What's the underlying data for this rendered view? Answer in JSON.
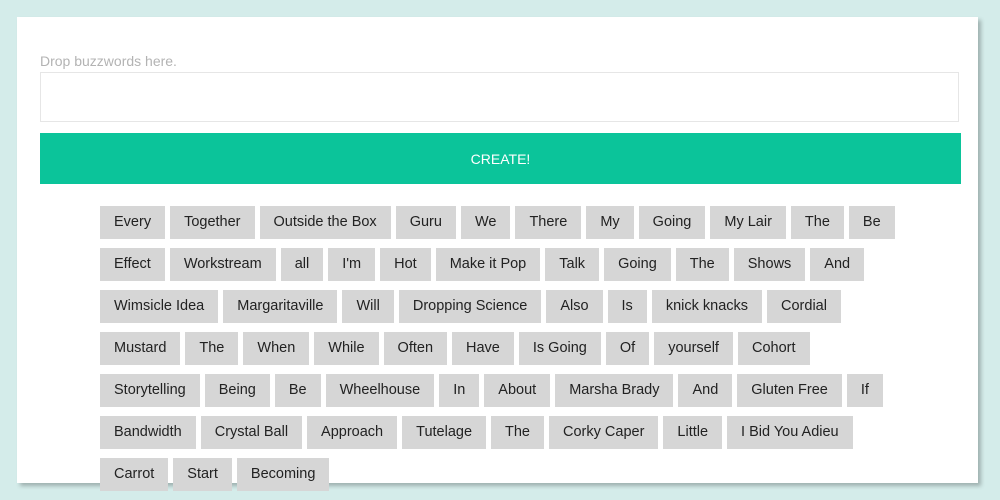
{
  "form": {
    "hint": "Drop buzzwords here.",
    "input_value": "",
    "create_label": "CREATE!"
  },
  "buzzwords": [
    "Every",
    "Together",
    "Outside the Box",
    "Guru",
    "We",
    "There",
    "My",
    "Going",
    "My Lair",
    "The",
    "Be",
    "Effect",
    "Workstream",
    "all",
    "I'm",
    "Hot",
    "Make it Pop",
    "Talk",
    "Going",
    "The",
    "Shows",
    "And",
    "Wimsicle Idea",
    "Margaritaville",
    "Will",
    "Dropping Science",
    "Also",
    "Is",
    "knick knacks",
    "Cordial",
    "Mustard",
    "The",
    "When",
    "While",
    "Often",
    "Have",
    "Is Going",
    "Of",
    "yourself",
    "Cohort",
    "Storytelling",
    "Being",
    "Be",
    "Wheelhouse",
    "In",
    "About",
    "Marsha Brady",
    "And",
    "Gluten Free",
    "If",
    "Bandwidth",
    "Crystal Ball",
    "Approach",
    "Tutelage",
    "The",
    "Corky Caper",
    "Little",
    "I Bid You Adieu",
    "Carrot",
    "Start",
    "Becoming"
  ],
  "colors": {
    "background": "#d4ecea",
    "accent": "#0bc49a",
    "chip": "#d6d6d6"
  }
}
